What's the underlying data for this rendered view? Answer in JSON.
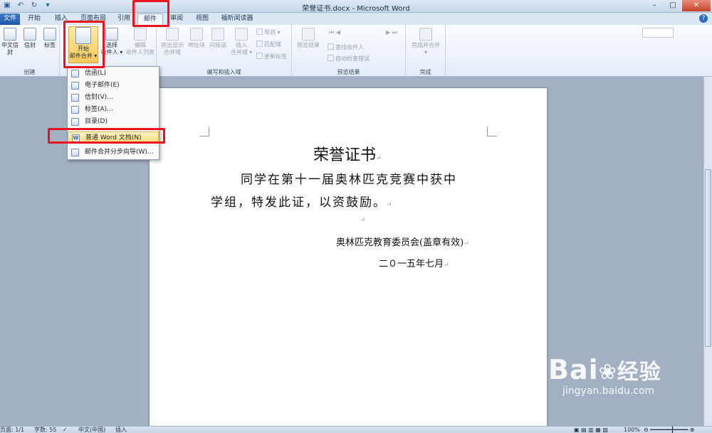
{
  "window": {
    "title": "荣誉证书.docx - Microsoft Word"
  },
  "tabs": [
    "文件",
    "开始",
    "插入",
    "页面布局",
    "引用",
    "邮件",
    "审阅",
    "视图",
    "福昕阅读器"
  ],
  "ribbon": {
    "create": {
      "label": "创建",
      "btn1": "中文信封",
      "btn2": "信封",
      "btn3": "标签"
    },
    "start_merge": {
      "line1": "开始",
      "line2": "邮件合并 ▾",
      "select_line1": "选择",
      "select_line2": "收件人 ▾",
      "edit_line1": "编辑",
      "edit_line2": "收件人列表"
    },
    "write_insert": {
      "label": "编写和插入域",
      "highlight_line1": "突出显示",
      "highlight_line2": "合并域",
      "address": "地址块",
      "greeting": "问候语",
      "insert_line1": "插入",
      "insert_line2": "合并域 ▾",
      "rules": "规则 ▾",
      "match": "匹配域",
      "update": "更新标签"
    },
    "preview": {
      "label": "预览结果",
      "preview_btn": "预览结果",
      "find": "查找收件人",
      "check": "自动检查错误"
    },
    "finish": {
      "label": "完成",
      "btn_line1": "完成并合并",
      "btn_line2": "▾"
    }
  },
  "menu": {
    "items": [
      {
        "label": "信函(L)",
        "icon": "letter-icon"
      },
      {
        "label": "电子邮件(E)",
        "icon": "email-icon"
      },
      {
        "label": "信封(V)...",
        "icon": "envelope-icon"
      },
      {
        "label": "标签(A)...",
        "icon": "label-icon"
      },
      {
        "label": "目录(D)",
        "icon": "directory-icon"
      },
      {
        "label": "普通 Word 文档(N)",
        "icon": "word-doc-icon"
      },
      {
        "label": "邮件合并分步向导(W)...",
        "icon": "wizard-icon"
      }
    ]
  },
  "document": {
    "title": "荣誉证书",
    "line1": "同学在第十一届奥林匹克竞赛中获中",
    "line2": "学组，特发此证，以资鼓励。",
    "org": "奥林匹克教育委员会(盖章有效)",
    "date": "二０一五年七月",
    "para_mark": "↵"
  },
  "status": {
    "page": "页面: 1/1",
    "words": "字数: 55",
    "lang": "中文(中国)",
    "mode": "插入",
    "zoom": "100%"
  },
  "watermark": {
    "brand": "Bai",
    "brand_cn": "经验",
    "url": "jingyan.baidu.com"
  },
  "colors": {
    "highlight_red": "#e8161c",
    "menu_highlight": "#fbdc7a",
    "file_tab": "#2b63b3"
  }
}
